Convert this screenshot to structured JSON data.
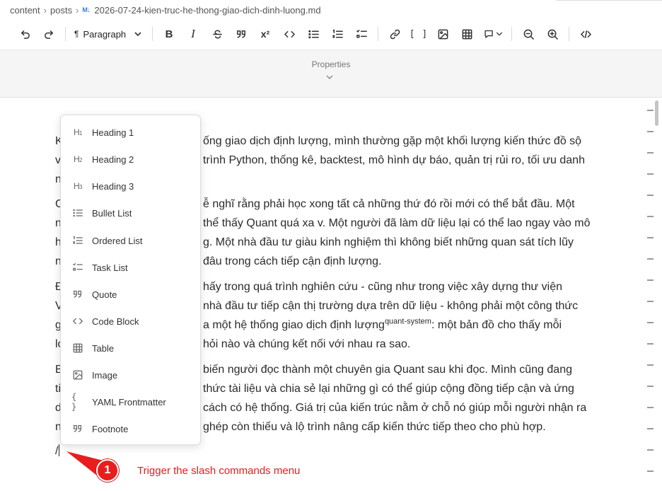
{
  "breadcrumb": {
    "segments": [
      "content",
      "posts"
    ],
    "file_icon": "M↓",
    "file_name": "2026-07-24-kien-truc-he-thong-giao-dich-dinh-luong.md"
  },
  "toolbar": {
    "paragraph_label": "Paragraph",
    "paragraph_icon": "¶",
    "buttons": [
      "undo-icon",
      "redo-icon",
      "bold-icon",
      "italic-icon",
      "strikethrough-icon",
      "quote-icon",
      "superscript-icon",
      "code-icon",
      "bullet-list-icon",
      "ordered-list-icon",
      "task-list-icon",
      "link-icon",
      "brackets-icon",
      "image-icon",
      "table-icon",
      "comment-icon",
      "zoom-out-icon",
      "zoom-in-icon",
      "source-code-icon"
    ],
    "bold_label": "B",
    "italic_label": "I",
    "superscript_label": "x²",
    "brackets_label": "[ ]"
  },
  "properties": {
    "label": "Properties"
  },
  "editor": {
    "p1": {
      "l1": "ống giao dịch định lượng, mình thường gặp một khối lượng kiến thức đồ sộ",
      "l2": "trình Python, thống kê, backtest, mô hình dự báo, quản trị rủi ro, tối ưu danh",
      "start1": "K",
      "start2": "v",
      "start3": "n"
    },
    "p2": {
      "l1": "ễ nghĩ rằng phải học xong tất cả những thứ đó rồi mới có thể bắt đầu. Một",
      "l2": "thể thấy Quant quá xa v. Một người đã làm dữ liệu lại có thể lao ngay vào mô",
      "l3": "g. Một nhà đầu tư giàu kinh nghiệm thì không biết những quan sát tích lũy",
      "l4": "đâu trong cách tiếp cận định lượng.",
      "start1": "C",
      "start2": "n",
      "start3": "h",
      "start4": "n"
    },
    "p3": {
      "l1": "hấy trong quá trình nghiên cứu - cũng như trong việc xây dựng thư viện",
      "l2": "nhà đầu tư tiếp cận thị trường dựa trên dữ liệu - không phải một công thức",
      "l3": "a một hệ thống giao dịch định lượng",
      "l3_sup": "quant-system",
      "l3_end": ": một bản đồ cho thấy mỗi",
      "l4": "hỏi nào và chúng kết nối với nhau ra sao.",
      "start1": "Đ",
      "start2": "V",
      "start3": "g",
      "start4": "lo"
    },
    "p4": {
      "l1": "biến người đọc thành một chuyên gia Quant sau khi đọc. Mình cũng đang",
      "l2": "thức tài liệu và chia sẻ lại những gì có thể giúp cộng đồng tiếp cận và ứng",
      "l3": "cách có hệ thống. Giá trị của kiến trúc nằm ở chỗ nó giúp mỗi người nhận ra",
      "l4": "ghép còn thiếu và lộ trình nâng cấp kiến thức tiếp theo cho phù hợp.",
      "start1": "B",
      "start2": "ti",
      "start3": "d",
      "start4": "n"
    },
    "slash_input": "/"
  },
  "slash_menu": {
    "items": [
      {
        "label": "Heading 1",
        "icon": "heading-1-icon"
      },
      {
        "label": "Heading 2",
        "icon": "heading-2-icon"
      },
      {
        "label": "Heading 3",
        "icon": "heading-3-icon"
      },
      {
        "label": "Bullet List",
        "icon": "bullet-list-icon"
      },
      {
        "label": "Ordered List",
        "icon": "ordered-list-icon"
      },
      {
        "label": "Task List",
        "icon": "task-list-icon"
      },
      {
        "label": "Quote",
        "icon": "quote-icon"
      },
      {
        "label": "Code Block",
        "icon": "code-icon"
      },
      {
        "label": "Table",
        "icon": "table-icon"
      },
      {
        "label": "Image",
        "icon": "image-icon"
      },
      {
        "label": "YAML Frontmatter",
        "icon": "braces-icon"
      },
      {
        "label": "Footnote",
        "icon": "footnote-icon"
      }
    ]
  },
  "annotation": {
    "number": "1",
    "text": "Trigger the slash commands menu",
    "color": "#e81e1e"
  }
}
